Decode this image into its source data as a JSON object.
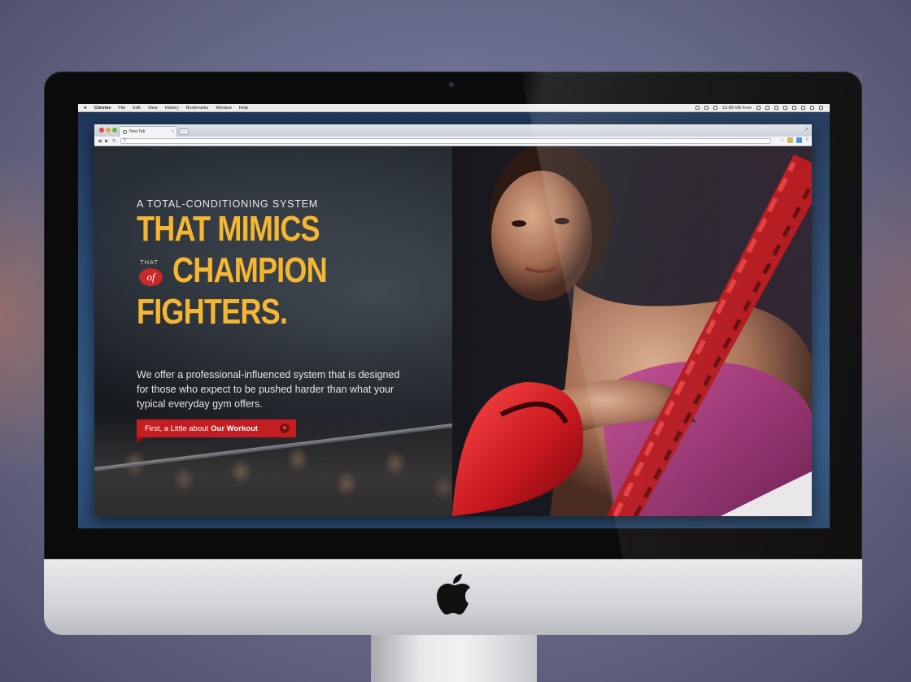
{
  "menubar": {
    "app_name": "Chrome",
    "menus": [
      "File",
      "Edit",
      "View",
      "History",
      "Bookmarks",
      "Window",
      "Help"
    ],
    "disk_status": "13.89 GB Free"
  },
  "browser": {
    "tab_title": "New Tab",
    "tab_close": "×",
    "address_value": ""
  },
  "hero": {
    "kicker": "A TOTAL-CONDITIONING SYSTEM",
    "headline_line1": "THAT MIMICS",
    "that_small": "THAT",
    "of_word": "of",
    "headline_line2": "CHAMPION",
    "headline_line3": "FIGHTERS.",
    "lead": "We offer a professional-influenced system that is designed for those who expect to be pushed harder than what your typical everyday gym offers.",
    "cta_prefix": "First, a Little about",
    "cta_emphasis": "Our Workout",
    "cta_arrow": "»"
  },
  "colors": {
    "headline": "#f5b731",
    "cta_background": "#c41e22",
    "of_badge": "#c8292b"
  }
}
